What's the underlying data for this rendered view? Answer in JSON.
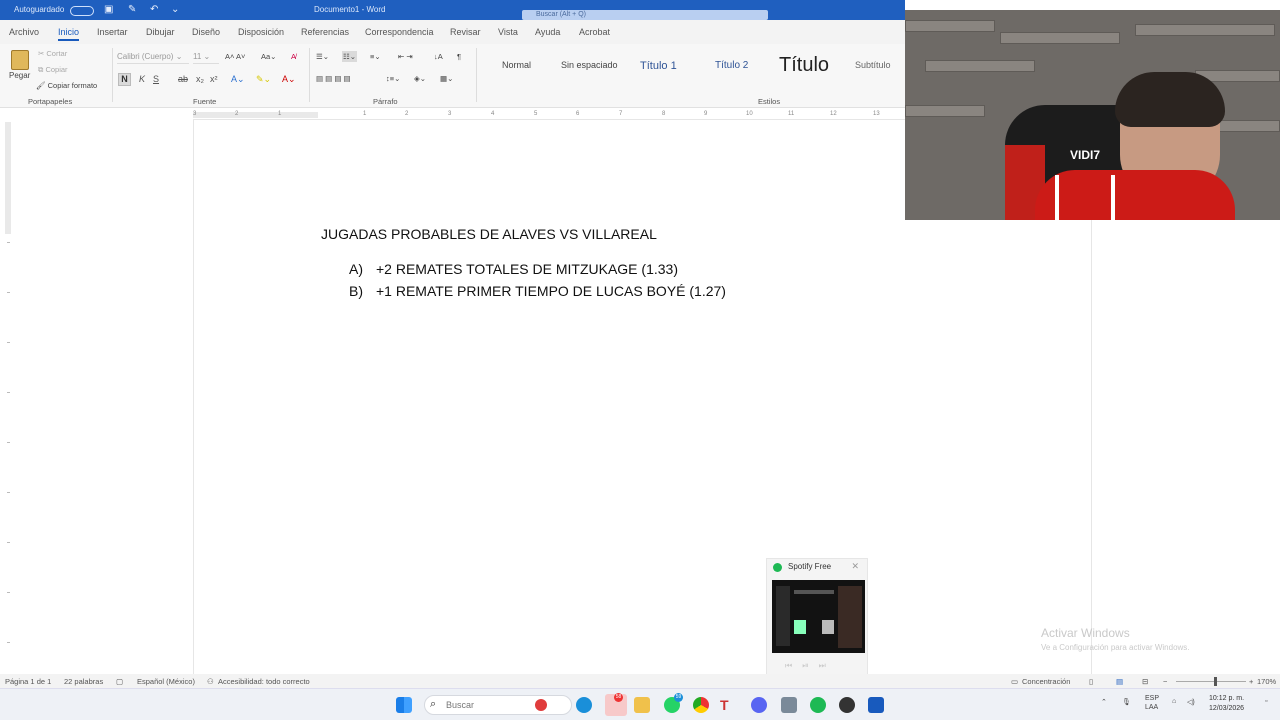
{
  "titlebar": {
    "autosave": "Autoguardado",
    "doc_title": "Documento1 - Word",
    "search_placeholder": "Buscar (Alt + Q)"
  },
  "tabs": [
    "Archivo",
    "Inicio",
    "Insertar",
    "Dibujar",
    "Diseño",
    "Disposición",
    "Referencias",
    "Correspondencia",
    "Revisar",
    "Vista",
    "Ayuda",
    "Acrobat"
  ],
  "active_tab": "Inicio",
  "ribbon": {
    "paste": "Pegar",
    "cut": "Cortar",
    "copy": "Copiar",
    "format_painter": "Copiar formato",
    "font": "Calibri (Cuerpo)",
    "size": "11",
    "bold": "N",
    "italic": "K",
    "underline": "S",
    "groups": {
      "clipboard": "Portapapeles",
      "font": "Fuente",
      "paragraph": "Párrafo",
      "styles": "Estilos"
    },
    "styles": [
      {
        "label": "Normal"
      },
      {
        "label": "Sin espaciado"
      },
      {
        "label": "Título 1"
      },
      {
        "label": "Título 2"
      },
      {
        "label": "Título"
      },
      {
        "label": "Subtítulo"
      }
    ]
  },
  "ruler": {
    "ticks": [
      "3",
      "2",
      "1",
      "1",
      "2",
      "3",
      "4",
      "5",
      "6",
      "7",
      "8",
      "9",
      "10",
      "11",
      "12",
      "13"
    ]
  },
  "document": {
    "heading": "JUGADAS PROBABLES DE ALAVES VS VILLAREAL",
    "items": [
      {
        "marker": "A)",
        "text": "+2 REMATES TOTALES DE MITZUKAGE (1.33)"
      },
      {
        "marker": "B)",
        "text": "+1 REMATE PRIMER TIEMPO DE LUCAS BOYÉ (1.27)"
      }
    ]
  },
  "webcam": {
    "chair_text": "VIDI7"
  },
  "spotify_preview": {
    "title": "Spotify Free"
  },
  "watermark": {
    "line1": "Activar Windows",
    "line2": "Ve a Configuración para activar Windows."
  },
  "statusbar": {
    "page": "Página 1 de 1",
    "words": "22 palabras",
    "language": "Español (México)",
    "accessibility": "Accesibilidad: todo correcto",
    "focus": "Concentración",
    "zoom": "170%",
    "zoom_level": 0.55
  },
  "taskbar": {
    "search_placeholder": "Buscar",
    "badges": {
      "telegram": "58",
      "whatsapp": "59"
    },
    "tray_lang_1": "ESP",
    "tray_lang_2": "LAA",
    "time": "10:12 p. m.",
    "date": "12/03/2026"
  },
  "colors": {
    "word_blue": "#185abd",
    "titlebar": "#1f5fbf",
    "spotify_green": "#1db954"
  }
}
